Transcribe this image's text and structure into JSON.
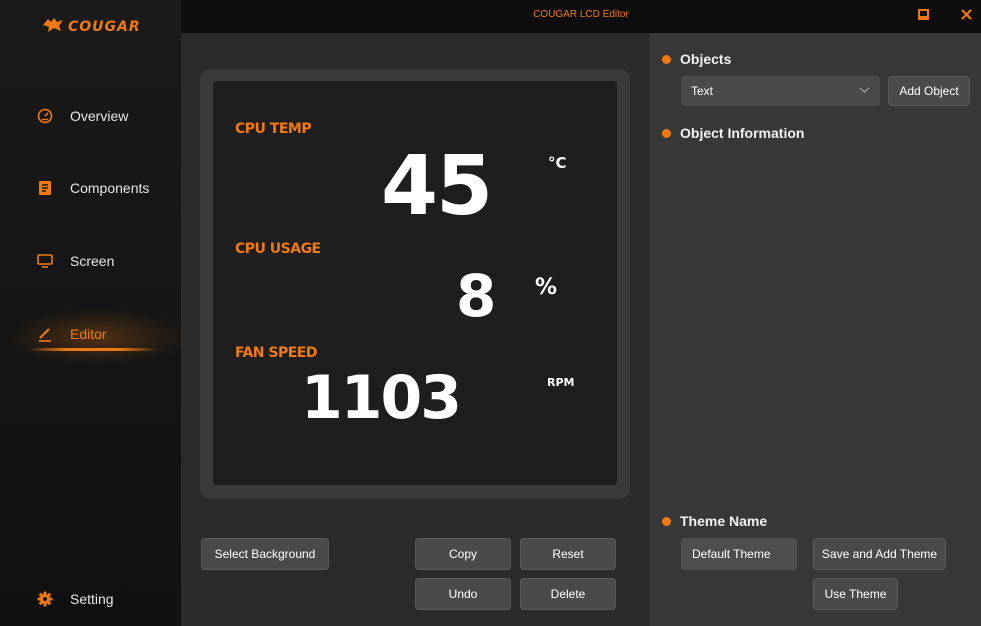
{
  "app": {
    "logo_text": "COUGAR",
    "window_title": "COUGAR LCD Editor"
  },
  "sidebar": {
    "items": [
      {
        "label": "Overview",
        "icon": "speedometer-icon"
      },
      {
        "label": "Components",
        "icon": "document-icon"
      },
      {
        "label": "Screen",
        "icon": "monitor-icon"
      },
      {
        "label": "Editor",
        "icon": "pencil-icon",
        "active": true
      },
      {
        "label": "Setting",
        "icon": "gear-icon"
      }
    ]
  },
  "preview": {
    "cpu_temp_label": "CPU TEMP",
    "cpu_temp_value": "45",
    "cpu_temp_unit": "°C",
    "cpu_usage_label": "CPU USAGE",
    "cpu_usage_value": "8",
    "cpu_usage_unit": "%",
    "fan_speed_label": "FAN SPEED",
    "fan_speed_value": "1103",
    "fan_speed_unit": "RPM"
  },
  "actions": {
    "select_background": "Select Background",
    "copy": "Copy",
    "reset": "Reset",
    "undo": "Undo",
    "delete": "Delete"
  },
  "objects": {
    "heading": "Objects",
    "selected": "Text",
    "add_button": "Add Object"
  },
  "object_information": {
    "heading": "Object Information"
  },
  "theme": {
    "heading": "Theme Name",
    "name_value": "Default Theme",
    "save_button": "Save and Add Theme",
    "use_button": "Use Theme"
  },
  "colors": {
    "accent": "#f07a10",
    "sidebar_bg": "#141414",
    "center_bg": "#2b2b2b",
    "right_bg": "#383838",
    "button_bg": "#4a4a4a"
  }
}
